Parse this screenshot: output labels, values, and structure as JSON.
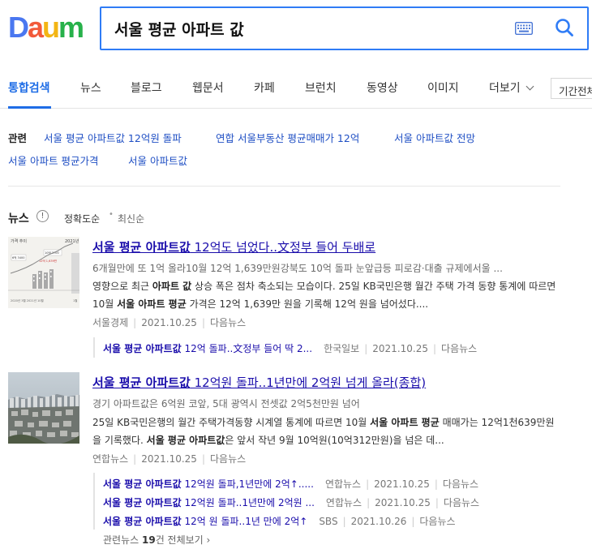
{
  "logo": {
    "text": "Daum"
  },
  "search": {
    "query": "서울 평균 아파트 값"
  },
  "tabs": [
    {
      "label": "통합검색"
    },
    {
      "label": "뉴스"
    },
    {
      "label": "블로그"
    },
    {
      "label": "웹문서"
    },
    {
      "label": "카페"
    },
    {
      "label": "브런치"
    },
    {
      "label": "동영상"
    },
    {
      "label": "이미지"
    },
    {
      "label": "더보기"
    }
  ],
  "period": {
    "label": "기간전체"
  },
  "related": {
    "title": "관련",
    "links": [
      "서울 평균 아파트값 12억원 돌파",
      "연합 서울부동산 평균매매가 12억",
      "서울 아파트값 전망",
      "서울 아파트 평균가격",
      "서울 아파트값"
    ]
  },
  "news": {
    "title": "뉴스",
    "info_icon": "!",
    "sort_accuracy": "정확도순",
    "sort_latest": "최신순",
    "items": [
      {
        "title_bold": "서울 평균 아파트값",
        "title_rest": " 12억도 넘었다..文정부 들어 두배로",
        "subtitle": "6개월만에 또 1억 올라10월 12억 1,639만원강북도 10억 돌파 눈앞급등 피로감·대출 규제에서울 ...",
        "body_1": "영향으로 최근 ",
        "body_b1": "아파트 값",
        "body_2": " 상승 폭은 점차 축소되는 모습이다. 25일 KB국민은행 월간 주택 가격 동향 통계에 따르면 10월 ",
        "body_b2": "서울 아파트 평균",
        "body_3": " 가격은 12억 1,639만 원을 기록해 12억 원을 넘어섰다....",
        "source": "서울경제",
        "date": "2021.10.25",
        "portal": "다음뉴스",
        "thumb_labels": {
          "top": "가격 추이",
          "year": "2021년",
          "bottom_left": "2020년 3월  2021년 10월",
          "bottom_right": "1월",
          "value_a": "6억 3400",
          "value_b": "10억 3700",
          "value_c": "12억 1,639만"
        },
        "related": [
          {
            "bold": "서울 평균 아파트값",
            "rest": " 12억 돌파..文정부 들어 딱 2...",
            "source": "한국일보",
            "date": "2021.10.25",
            "portal": "다음뉴스"
          }
        ]
      },
      {
        "title_bold": "서울 평균 아파트값",
        "title_rest": " 12억원 돌파..1년만에 2억원 넘게 올라(종합)",
        "subtitle": "경기 아파트값은 6억원 코앞, 5대 광역시 전셋값 2억5천만원 넘어",
        "body_1": "25일 KB국민은행의 월간 주택가격동향 시계열 통계에 따르면 10월 ",
        "body_b1": "서울 아파트 평균",
        "body_2": " 매매가는 12억1천639만원을 기록했다. ",
        "body_b2": "서울 평균 아파트값",
        "body_3": "은 앞서 작년 9월 10억원(10억312만원)을 넘은 데...",
        "source": "연합뉴스",
        "date": "2021.10.25",
        "portal": "다음뉴스",
        "related": [
          {
            "bold": "서울 평균 아파트값",
            "rest": " 12억원 돌파,1년만에 2억↑.....",
            "source": "연합뉴스",
            "date": "2021.10.25",
            "portal": "다음뉴스"
          },
          {
            "bold": "서울 평균 아파트값",
            "rest": " 12억원 돌파..1년만에 2억원 ...",
            "source": "연합뉴스",
            "date": "2021.10.25",
            "portal": "다음뉴스"
          },
          {
            "bold": "서울 평균 아파트값",
            "rest": " 12억 원 돌파..1년 만에 2억↑",
            "source": "SBS",
            "date": "2021.10.26",
            "portal": "다음뉴스"
          }
        ],
        "more_prefix": "관련뉴스 ",
        "more_count": "19",
        "more_suffix": "건 전체보기",
        "more_chevron": "›"
      }
    ]
  },
  "colors": {
    "accent": "#1f6de6",
    "link": "#1a0dab",
    "related_link": "#1f4fc4",
    "search_border": "#2f7cf6"
  }
}
